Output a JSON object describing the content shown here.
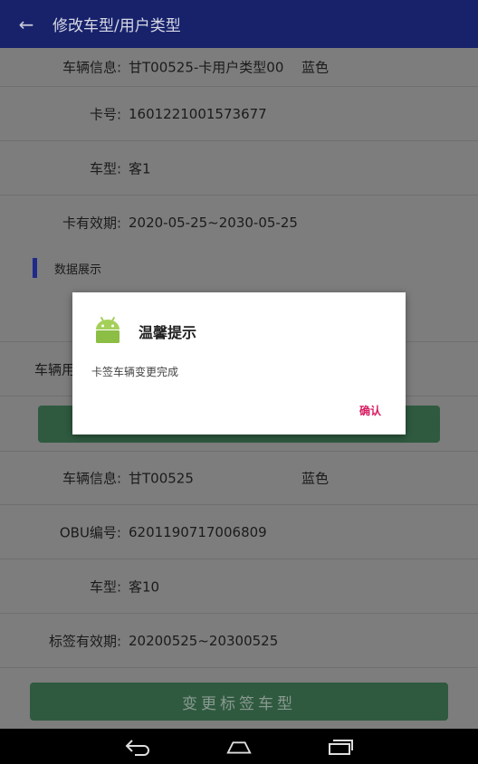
{
  "appbar": {
    "title": "修改车型/用户类型"
  },
  "card": {
    "vehicle_label": "车辆信息:",
    "vehicle_value": "甘T00525-卡用户类型00",
    "vehicle_color": "蓝色",
    "card_no_label": "卡号:",
    "card_no_value": "1601221001573677",
    "type_label": "车型:",
    "type_value": "客1",
    "validity_label": "卡有效期:",
    "validity_value": "2020-05-25~2030-05-25"
  },
  "section": {
    "title": "数据展示"
  },
  "partial_row": {
    "label": "车辆用"
  },
  "obu": {
    "vehicle_label": "车辆信息:",
    "vehicle_value": "甘T00525",
    "vehicle_color": "蓝色",
    "obu_label": "OBU编号:",
    "obu_value": "6201190717006809",
    "type_label": "车型:",
    "type_value": "客10",
    "validity_label": "标签有效期:",
    "validity_value": "20200525~20300525"
  },
  "bottom_button": {
    "label": "变更标签车型"
  },
  "dialog": {
    "title": "温馨提示",
    "message": "卡签车辆变更完成",
    "ok_label": "确认"
  },
  "icons": {
    "back": "arrow-left-icon",
    "dialog": "android-icon",
    "nav_back": "nav-back-icon",
    "nav_home": "nav-home-icon",
    "nav_recents": "nav-recents-icon"
  },
  "colors": {
    "appbar": "#17226b",
    "accent_green": "#2f5a40",
    "section_bar": "#1f2a8a",
    "dialog_button": "#d81b60",
    "android_green": "#9ccd4e"
  }
}
